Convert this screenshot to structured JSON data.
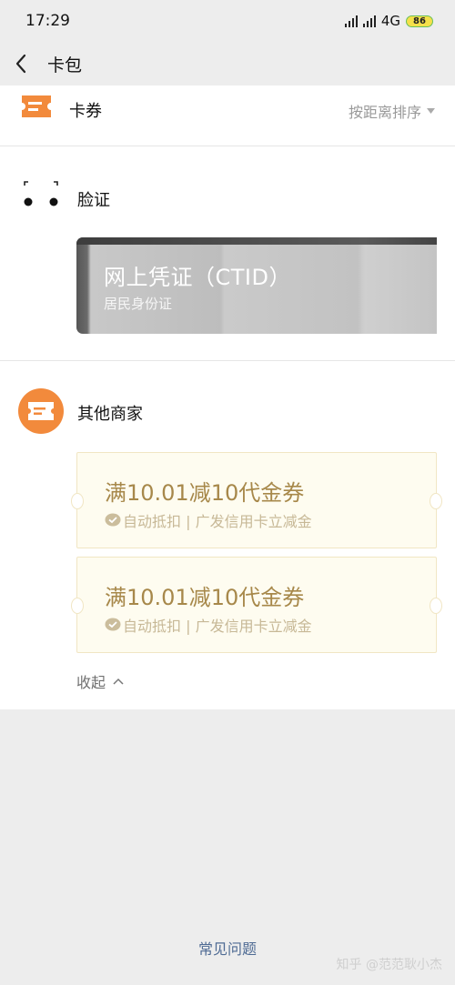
{
  "status_bar": {
    "time": "17:29",
    "network": "4G",
    "battery": "86"
  },
  "nav": {
    "title": "卡包"
  },
  "card_section": {
    "title": "卡券",
    "sort_label": "按距离排序"
  },
  "verify_section": {
    "title": "脸证",
    "card": {
      "title": "网上凭证（CTID）",
      "subtitle": "居民身份证"
    }
  },
  "merchant_section": {
    "title": "其他商家",
    "vouchers": [
      {
        "title": "满10.01减10代金券",
        "subtitle": "自动抵扣 | 广发信用卡立减金"
      },
      {
        "title": "满10.01减10代金券",
        "subtitle": "自动抵扣 | 广发信用卡立减金"
      }
    ],
    "collapse_label": "收起"
  },
  "footer": {
    "faq_label": "常见问题",
    "watermark": "知乎 @范范耿小杰"
  },
  "colors": {
    "accent": "#f28a3c",
    "voucher_text": "#a7884a",
    "link": "#4f6b94"
  }
}
